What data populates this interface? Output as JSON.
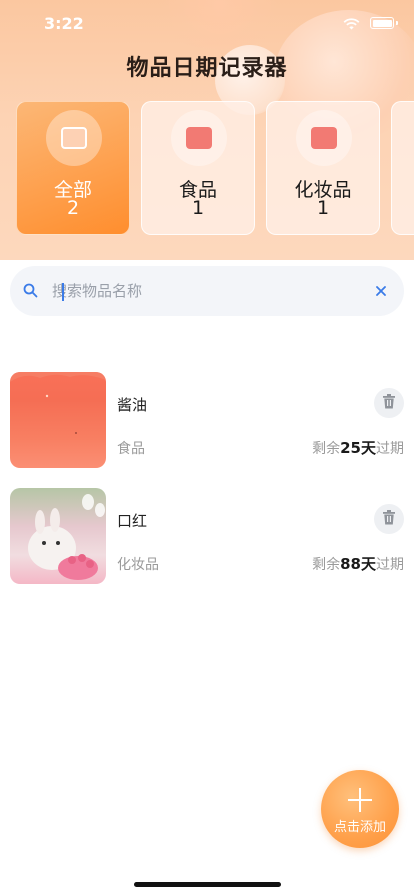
{
  "status_bar": {
    "time": "3:22"
  },
  "app_title": "物品日期记录器",
  "categories": [
    {
      "name": "全部",
      "count": "2",
      "active": true
    },
    {
      "name": "食品",
      "count": "1",
      "active": false
    },
    {
      "name": "化妆品",
      "count": "1",
      "active": false
    }
  ],
  "search": {
    "placeholder": "搜索物品名称",
    "value": ""
  },
  "items": [
    {
      "name": "酱油",
      "category": "食品",
      "remaining_prefix": "剩余",
      "days": "25天",
      "remaining_suffix": "过期"
    },
    {
      "name": "口红",
      "category": "化妆品",
      "remaining_prefix": "剩余",
      "days": "88天",
      "remaining_suffix": "过期"
    }
  ],
  "fab": {
    "label": "点击添加"
  },
  "colors": {
    "accent": "#ff9a3f",
    "header_bg": "#fdd3b4",
    "search_icon": "#3a7be8"
  }
}
